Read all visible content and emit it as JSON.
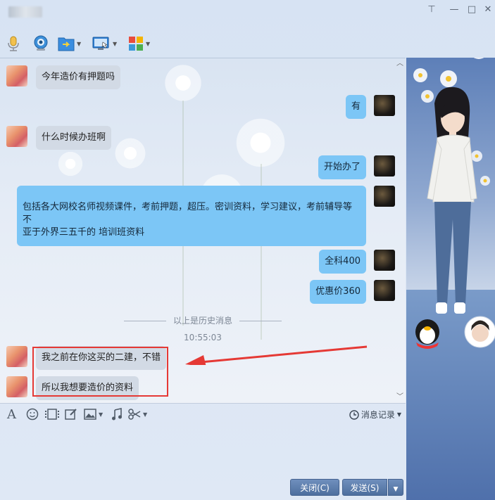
{
  "window": {
    "controls": {
      "pin": "⊤",
      "minimize": "—",
      "maximize": "□",
      "close": "✕"
    }
  },
  "toolbar": {
    "tools": [
      {
        "name": "microphone-icon",
        "caret": false
      },
      {
        "name": "webcam-icon",
        "caret": false
      },
      {
        "name": "send-file-icon",
        "caret": true
      },
      {
        "name": "remote-desktop-icon",
        "caret": true
      },
      {
        "name": "apps-icon",
        "caret": true
      }
    ]
  },
  "chat": {
    "messages": [
      {
        "side": "in",
        "text": "今年造价有押题吗"
      },
      {
        "side": "out",
        "text": "有"
      },
      {
        "side": "in",
        "text": "什么时候办班啊"
      },
      {
        "side": "out",
        "text": "开始办了"
      },
      {
        "side": "out",
        "text": "包括各大网校名师视频课件，考前押题，超压。密训资料，学习建议，考前辅导等不\n亚于外界三五千的 培训班资料"
      },
      {
        "side": "out",
        "text": "全科400"
      },
      {
        "side": "out",
        "text": "优惠价360"
      },
      {
        "side": "in",
        "text": "我之前在你这买的二建，不错"
      },
      {
        "side": "in",
        "text": "所以我想要造价的资料"
      }
    ],
    "history_divider": "以上是历史消息",
    "timestamp": "10:55:03"
  },
  "input_toolbar": {
    "history_label": "消息记录"
  },
  "buttons": {
    "close_label": "关闭(C)",
    "send_label": "发送(S)"
  },
  "colors": {
    "incoming_bubble": "#d2dae5",
    "outgoing_bubble": "#7cc6f6",
    "highlight_box": "#e53935",
    "button": "#5a7aab"
  }
}
